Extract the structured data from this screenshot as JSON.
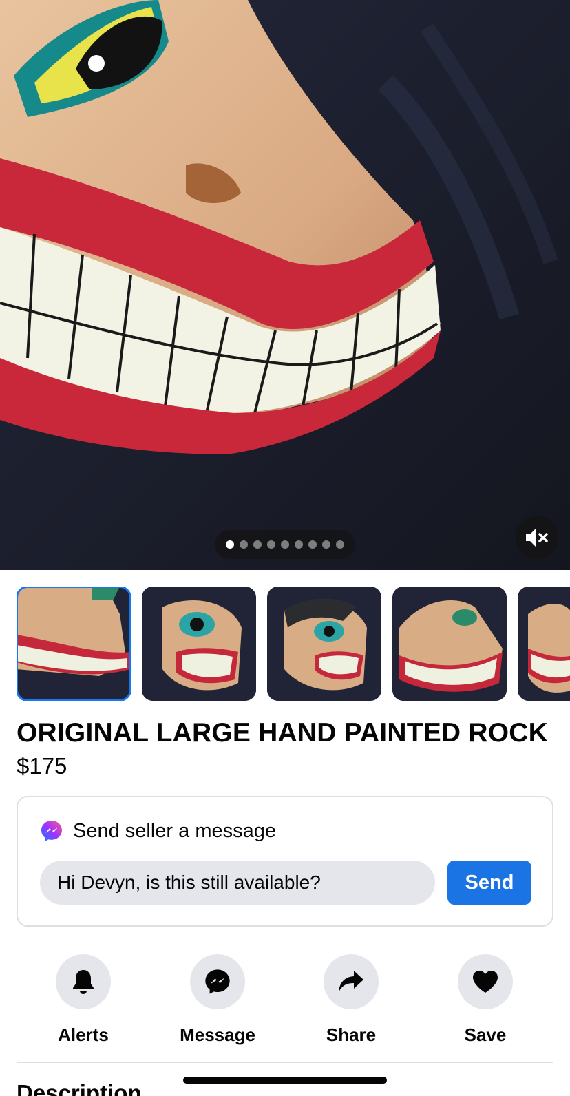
{
  "listing": {
    "title": "ORIGINAL LARGE HAND PAINTED ROCK",
    "price": "$175"
  },
  "media": {
    "photo_count": 9,
    "active_index": 0,
    "mute_icon": "speaker-muted-icon",
    "thumbnail_count_visible": 5
  },
  "message_card": {
    "heading": "Send seller a message",
    "icon": "messenger-icon",
    "input_value": "Hi Devyn, is this still available?",
    "send_label": "Send"
  },
  "actions": [
    {
      "label": "Alerts",
      "icon": "bell-icon"
    },
    {
      "label": "Message",
      "icon": "messenger-icon"
    },
    {
      "label": "Share",
      "icon": "share-arrow-icon"
    },
    {
      "label": "Save",
      "icon": "heart-icon"
    }
  ],
  "description": {
    "heading": "Description"
  },
  "colors": {
    "accent": "#1b74e4",
    "selected_thumb_border": "#1877f2",
    "chip_bg": "#e4e6eb",
    "background": "#ffffff"
  }
}
